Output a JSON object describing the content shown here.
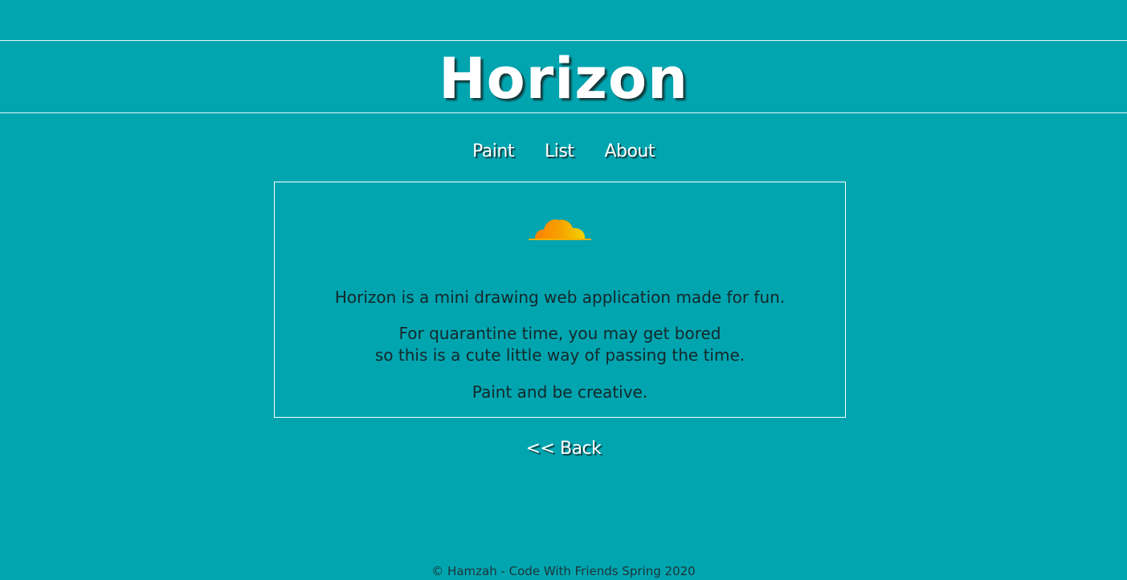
{
  "header": {
    "title": "Horizon"
  },
  "nav": {
    "items": [
      {
        "label": "Paint"
      },
      {
        "label": "List"
      },
      {
        "label": "About"
      }
    ]
  },
  "about": {
    "logo_icon": "horizon-cloud-icon",
    "paragraph_1": "Horizon is a mini drawing web application made for fun.",
    "paragraph_2_line_1": "For quarantine time, you may get bored",
    "paragraph_2_line_2": "so this is a cute little way of passing the time.",
    "paragraph_3": "Paint and be creative."
  },
  "back_link": {
    "label": "<< Back"
  },
  "footer": {
    "text": "© Hamzah - Code With Friends Spring 2020"
  },
  "colors": {
    "background": "#00a5b0",
    "text_dark": "#14282a",
    "text_light": "#ffffff",
    "logo_orange": "#ff8a00",
    "logo_yellow": "#f4d000"
  }
}
